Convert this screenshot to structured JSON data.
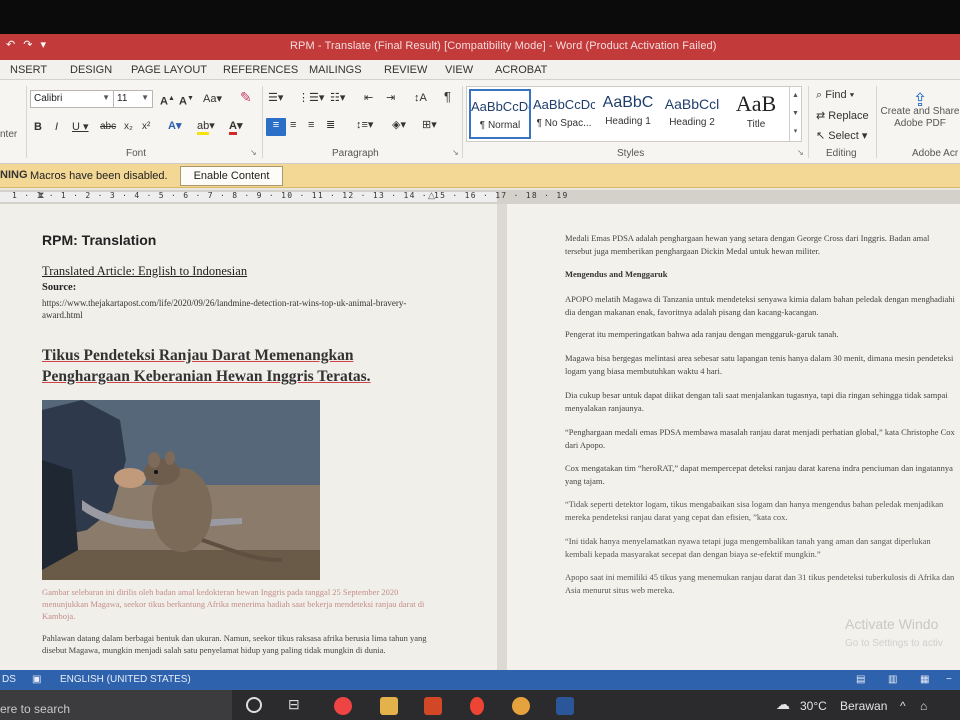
{
  "window": {
    "title": "RPM - Translate (Final Result) [Compatibility Mode] - Word (Product Activation Failed)"
  },
  "ribbon_tabs": [
    "NSERT",
    "DESIGN",
    "PAGE LAYOUT",
    "REFERENCES",
    "MAILINGS",
    "REVIEW",
    "VIEW",
    "ACROBAT"
  ],
  "ribbon": {
    "left_cut_label": "nter",
    "font": {
      "name": "Calibri",
      "size": "11",
      "group_label": "Font"
    },
    "paragraph": {
      "group_label": "Paragraph"
    },
    "styles": {
      "group_label": "Styles",
      "items": [
        {
          "sample": "AaBbCcDc",
          "name": "¶ Normal"
        },
        {
          "sample": "AaBbCcDc",
          "name": "¶ No Spac..."
        },
        {
          "sample": "AaBbC",
          "name": "Heading 1"
        },
        {
          "sample": "AaBbCcl",
          "name": "Heading 2"
        },
        {
          "sample": "AaB",
          "name": "Title"
        }
      ]
    },
    "editing": {
      "group_label": "Editing",
      "find": "Find",
      "replace": "Replace",
      "select": "Select"
    },
    "adobe": {
      "create_label": "Create and Share Adobe PDF",
      "group_label": "Adobe Acr"
    }
  },
  "macro_bar": {
    "warning": "NING",
    "message": "Macros have been disabled.",
    "button": "Enable Content"
  },
  "ruler": {
    "numbers": "1 · 1 · 1 · 2 · 3 · 4 · 5 · 6 · 7 · 8 · 9 · 10 · 11 · 12 · 13 · 14 · 15 · 16 · 17 · 18 · 19"
  },
  "left_page": {
    "heading": "RPM: Translation",
    "subheading": "Translated Article: English to Indonesian",
    "source_label": "Source:",
    "url": "https://www.thejakartapost.com/life/2020/09/26/landmine-detection-rat-wins-top-uk-animal-bravery-award.html",
    "title": "Tikus Pendeteksi Ranjau Darat Memenangkan Penghargaan Keberanian Hewan Inggris Teratas.",
    "caption": "Gambar selebaran ini dirilis oleh badan amal kedokteran hewan Inggris pada tanggal 25 September 2020 menunjukkan Magawa, seekor tikus berkantung Afrika menerima hadiah saat bekerja mendeteksi ranjau darat di Kamboja.",
    "body": "Pahlawan datang dalam berbagai bentuk dan ukuran. Namun, seekor tikus raksasa afrika berusia lima tahun yang disebut Magawa, mungkin menjadi salah satu penyelamat hidup yang paling tidak mungkin di dunia."
  },
  "right_page": {
    "paragraphs": [
      "Medali Emas PDSA adalah penghargaan hewan yang setara dengan George Cross dari Inggris. Badan amal tersebut juga memberikan penghargaan Dickin Medal untuk hewan militer.",
      "Mengendus and Menggaruk",
      "APOPO melatih Magawa di Tanzania untuk mendeteksi senyawa kimia dalam bahan peledak dengan menghadiahi dia dengan makanan enak, favoritnya adalah pisang dan kacang-kacangan.",
      "Pengerat itu memperingatkan bahwa ada ranjau dengan menggaruk-garuk tanah.",
      "Magawa bisa bergegas melintasi area sebesar satu lapangan tenis hanya dalam 30 menit, dimana mesin pendeteksi logam yang biasa membutuhkan waktu 4 hari.",
      "Dia cukup besar untuk dapat diikat dengan tali saat menjalankan tugasnya, tapi dia ringan sehingga tidak sampai menyalakan ranjaunya.",
      "“Penghargaan medali emas PDSA membawa masalah ranjau darat menjadi perhatian global,” kata Christophe Cox dari Apopo.",
      "Cox mengatakan tim “heroRAT,” dapat mempercepat deteksi ranjau darat karena indra penciuman dan ingatannya yang tajam.",
      "“Tidak seperti detektor logam, tikus mengabaikan sisa logam dan hanya mengendus bahan peledak menjadikan mereka pendeteksi ranjau darat yang cepat dan efisien, ”kata cox.",
      "“Ini tidak hanya menyelamatkan nyawa tetapi juga mengembalikan tanah yang aman dan sangat diperlukan kembali kepada masyarakat secepat dan dengan biaya se-efektif mungkin.”",
      "Apopo saat ini memiliki 45 tikus yang menemukan ranjau darat dan 31 tikus pendeteksi tuberkulosis di Afrika dan Asia menurut situs web mereka."
    ]
  },
  "watermark": {
    "line1": "Activate Windo",
    "line2": "Go to Settings to activ"
  },
  "status_bar": {
    "left": "DS",
    "language": "ENGLISH (UNITED STATES)"
  },
  "taskbar": {
    "search_text": "ere to search",
    "weather": "30°C",
    "weather_desc": "Berawan"
  },
  "colors": {
    "title_bar": "#c23a3a",
    "status_bar": "#2f62ad",
    "macro_bar": "#f3d795",
    "accent_blue": "#2b6fc7"
  }
}
